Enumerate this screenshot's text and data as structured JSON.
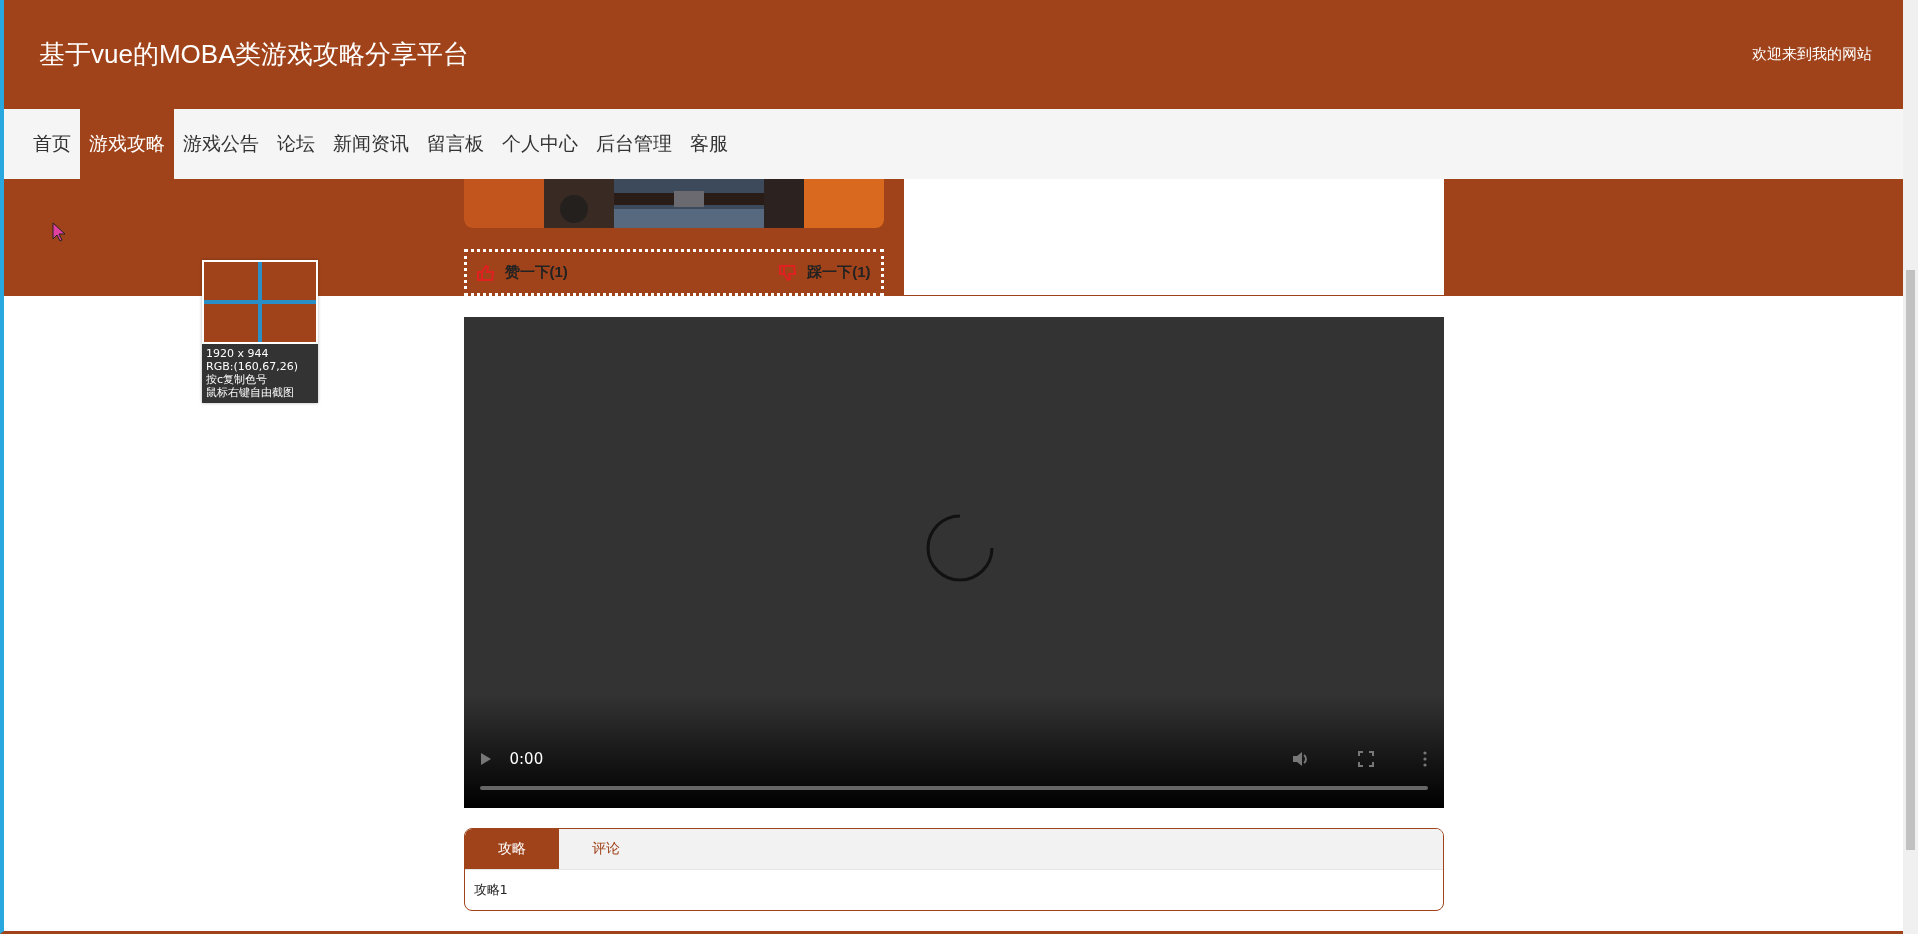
{
  "header": {
    "title": "基于vue的MOBA类游戏攻略分享平台",
    "welcome": "欢迎来到我的网站"
  },
  "nav": [
    {
      "label": "首页",
      "selected": false
    },
    {
      "label": "游戏攻略",
      "selected": true
    },
    {
      "label": "游戏公告",
      "selected": false
    },
    {
      "label": "论坛",
      "selected": false
    },
    {
      "label": "新闻资讯",
      "selected": false
    },
    {
      "label": "留言板",
      "selected": false
    },
    {
      "label": "个人中心",
      "selected": false
    },
    {
      "label": "后台管理",
      "selected": false
    },
    {
      "label": "客服",
      "selected": false
    }
  ],
  "votes": {
    "like": "赞一下(1)",
    "dislike": "踩一下(1)"
  },
  "video": {
    "time": "0:00"
  },
  "tabs": [
    {
      "label": "攻略",
      "selected": true
    },
    {
      "label": "评论",
      "selected": false
    }
  ],
  "tab_content": "攻略1",
  "color_picker": {
    "lines": [
      "1920 x 944",
      "RGB:(160,67,26)",
      "按c复制色号",
      "鼠标右键自由截图"
    ]
  }
}
